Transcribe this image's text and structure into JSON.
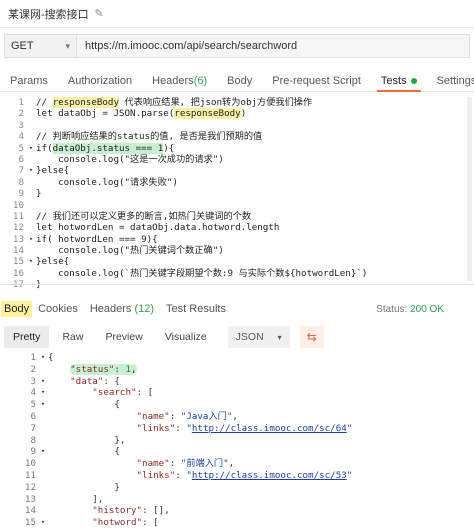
{
  "title": "某课网-搜索接口",
  "request": {
    "method": "GET",
    "url": "https://m.imooc.com/api/search/searchword"
  },
  "request_tabs": [
    {
      "label": "Params",
      "count": ""
    },
    {
      "label": "Authorization",
      "count": ""
    },
    {
      "label": "Headers",
      "count": "(6)"
    },
    {
      "label": "Body",
      "count": ""
    },
    {
      "label": "Pre-request Script",
      "count": ""
    },
    {
      "label": "Tests",
      "count": ""
    },
    {
      "label": "Settings",
      "count": ""
    }
  ],
  "script_lines": [
    {
      "n": "1",
      "fold": "",
      "hl": "",
      "code": "// responseBody 代表响应结果, 把json转为obj方便我们操作",
      "cls": "cm"
    },
    {
      "n": "2",
      "fold": "",
      "hl": "",
      "code": "let dataObj = JSON.parse(responseBody)",
      "cls": ""
    },
    {
      "n": "3",
      "fold": "",
      "hl": "",
      "code": "",
      "cls": ""
    },
    {
      "n": "4",
      "fold": "",
      "hl": "",
      "code": "// 判断响应结果的status的值, 是否是我们预期的值",
      "cls": "cm"
    },
    {
      "n": "5",
      "fold": "▾",
      "hl": "",
      "code": "if(dataObj.status === 1){",
      "cls": ""
    },
    {
      "n": "6",
      "fold": "",
      "hl": "",
      "code": "    console.log(\"这是一次成功的请求\")",
      "cls": ""
    },
    {
      "n": "7",
      "fold": "▾",
      "hl": "",
      "code": "}else{",
      "cls": ""
    },
    {
      "n": "8",
      "fold": "",
      "hl": "",
      "code": "    console.log(\"请求失败\")",
      "cls": ""
    },
    {
      "n": "9",
      "fold": "",
      "hl": "",
      "code": "}",
      "cls": ""
    },
    {
      "n": "10",
      "fold": "",
      "hl": "",
      "code": "",
      "cls": ""
    },
    {
      "n": "11",
      "fold": "",
      "hl": "",
      "code": "// 我们还可以定义更多的断言,如热门关键词的个数",
      "cls": "cm"
    },
    {
      "n": "12",
      "fold": "",
      "hl": "",
      "code": "let hotwordLen = dataObj.data.hotword.length",
      "cls": ""
    },
    {
      "n": "13",
      "fold": "▾",
      "hl": "",
      "code": "if( hotwordLen === 9){",
      "cls": ""
    },
    {
      "n": "14",
      "fold": "",
      "hl": "",
      "code": "    console.log(\"热门关键词个数正确\")",
      "cls": ""
    },
    {
      "n": "15",
      "fold": "▾",
      "hl": "",
      "code": "}else{",
      "cls": ""
    },
    {
      "n": "16",
      "fold": "",
      "hl": "",
      "code": "    console.log(`热门关键字段期望个数:9 与实际个数${hotwordLen}`)",
      "cls": ""
    },
    {
      "n": "17",
      "fold": "",
      "hl": "",
      "code": "}",
      "cls": ""
    }
  ],
  "response_tabs": [
    {
      "label": "Body",
      "count": ""
    },
    {
      "label": "Cookies",
      "count": ""
    },
    {
      "label": "Headers",
      "count": "(12)"
    },
    {
      "label": "Test Results",
      "count": ""
    }
  ],
  "status": {
    "label": "Status:",
    "value": "200 OK"
  },
  "view_modes": [
    "Pretty",
    "Raw",
    "Preview",
    "Visualize"
  ],
  "format": "JSON",
  "json_lines": [
    {
      "n": "1",
      "fold": "▾",
      "indent": "",
      "parts": [
        [
          "p",
          "{"
        ]
      ]
    },
    {
      "n": "2",
      "fold": "",
      "indent": "    ",
      "parts": [
        [
          "k",
          "\"status\""
        ],
        [
          "p",
          ": "
        ],
        [
          "num",
          "1"
        ],
        [
          "p",
          ","
        ]
      ],
      "hl": true
    },
    {
      "n": "3",
      "fold": "▾",
      "indent": "    ",
      "parts": [
        [
          "k",
          "\"data\""
        ],
        [
          "p",
          ": {"
        ]
      ]
    },
    {
      "n": "4",
      "fold": "▾",
      "indent": "        ",
      "parts": [
        [
          "k",
          "\"search\""
        ],
        [
          "p",
          ": ["
        ]
      ]
    },
    {
      "n": "5",
      "fold": "▾",
      "indent": "            ",
      "parts": [
        [
          "p",
          "{"
        ]
      ]
    },
    {
      "n": "6",
      "fold": "",
      "indent": "                ",
      "parts": [
        [
          "k",
          "\"name\""
        ],
        [
          "p",
          ": "
        ],
        [
          "s",
          "\"Java入门\""
        ],
        [
          "p",
          ","
        ]
      ]
    },
    {
      "n": "7",
      "fold": "",
      "indent": "                ",
      "parts": [
        [
          "k",
          "\"links\""
        ],
        [
          "p",
          ": "
        ],
        [
          "s",
          "\""
        ],
        [
          "l",
          "http://class.imooc.com/sc/64"
        ],
        [
          "s",
          "\""
        ]
      ]
    },
    {
      "n": "8",
      "fold": "",
      "indent": "            ",
      "parts": [
        [
          "p",
          "},"
        ]
      ]
    },
    {
      "n": "9",
      "fold": "▾",
      "indent": "            ",
      "parts": [
        [
          "p",
          "{"
        ]
      ]
    },
    {
      "n": "10",
      "fold": "",
      "indent": "                ",
      "parts": [
        [
          "k",
          "\"name\""
        ],
        [
          "p",
          ": "
        ],
        [
          "s",
          "\"前端入门\""
        ],
        [
          "p",
          ","
        ]
      ]
    },
    {
      "n": "11",
      "fold": "",
      "indent": "                ",
      "parts": [
        [
          "k",
          "\"links\""
        ],
        [
          "p",
          ": "
        ],
        [
          "s",
          "\""
        ],
        [
          "l",
          "http://class.imooc.com/sc/53"
        ],
        [
          "s",
          "\""
        ]
      ]
    },
    {
      "n": "12",
      "fold": "",
      "indent": "            ",
      "parts": [
        [
          "p",
          "}"
        ]
      ]
    },
    {
      "n": "13",
      "fold": "",
      "indent": "        ",
      "parts": [
        [
          "p",
          "],"
        ]
      ]
    },
    {
      "n": "14",
      "fold": "",
      "indent": "        ",
      "parts": [
        [
          "k",
          "\"history\""
        ],
        [
          "p",
          ": [],"
        ]
      ]
    },
    {
      "n": "15",
      "fold": "▾",
      "indent": "        ",
      "parts": [
        [
          "k",
          "\"hotword\""
        ],
        [
          "p",
          ": ["
        ]
      ]
    }
  ]
}
